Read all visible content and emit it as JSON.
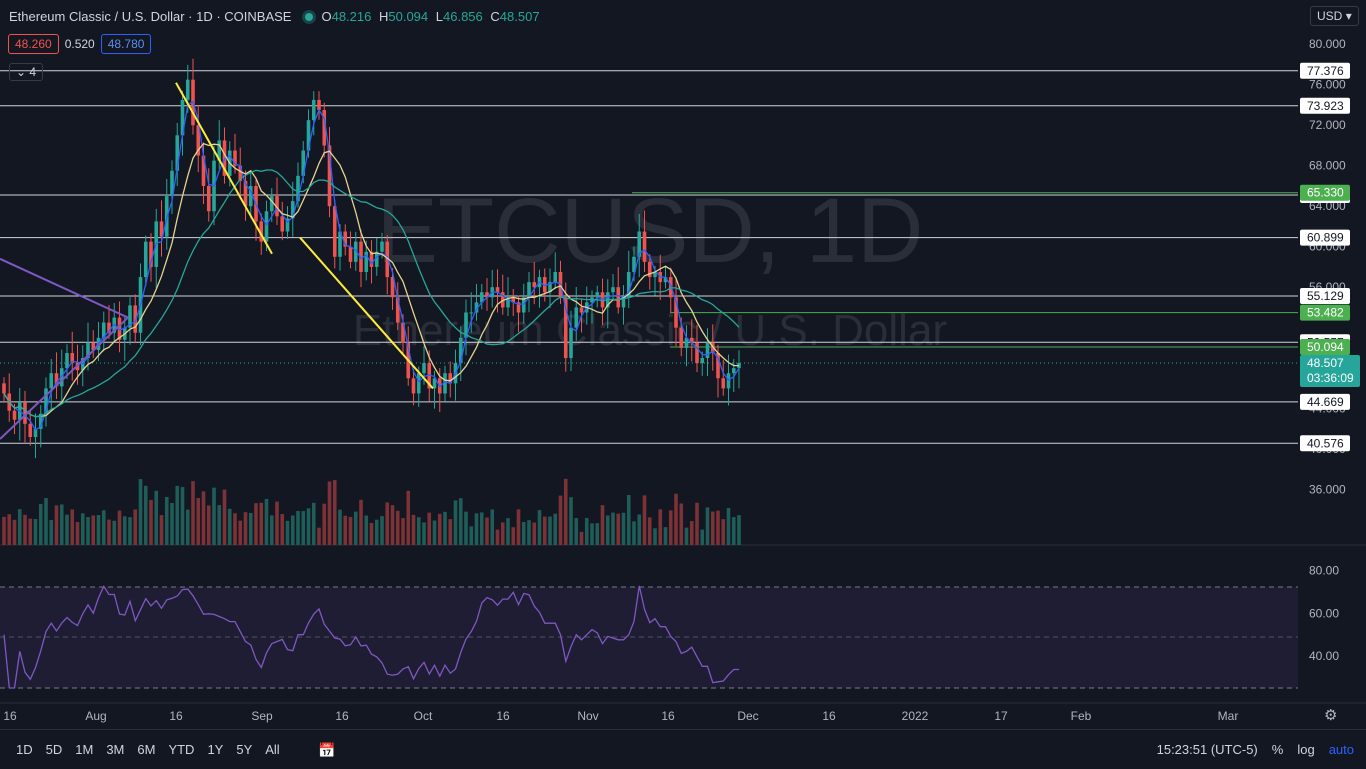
{
  "header": {
    "title": "Ethereum Classic / U.S. Dollar · 1D · COINBASE",
    "ohlc": [
      {
        "k": "O",
        "v": "48.216"
      },
      {
        "k": "H",
        "v": "50.094"
      },
      {
        "k": "L",
        "v": "46.856"
      },
      {
        "k": "C",
        "v": "48.507"
      }
    ]
  },
  "indicator": {
    "bid": "48.260",
    "spread": "0.520",
    "ask": "48.780"
  },
  "collapse_label": "4",
  "currency_button": "USD",
  "watermark": {
    "line1": "ETCUSD, 1D",
    "line2": "Ethereum Classic / U.S. Dollar"
  },
  "price_axis": {
    "min": 33,
    "max": 82,
    "ticks": [
      "80.000",
      "76.000",
      "72.000",
      "68.000",
      "64.000",
      "60.000",
      "56.000",
      "44.000",
      "40.000",
      "36.000"
    ],
    "tick_values": [
      80,
      76,
      72,
      68,
      64,
      60,
      56,
      44,
      40,
      36
    ]
  },
  "levels": [
    {
      "label": "77.376",
      "value": 77.376,
      "color": "#ffffff"
    },
    {
      "label": "73.923",
      "value": 73.923,
      "color": "#ffffff"
    },
    {
      "label": "65.108",
      "value": 65.108,
      "color": "#ffffff"
    },
    {
      "label": "60.899",
      "value": 60.899,
      "color": "#ffffff"
    },
    {
      "label": "55.129",
      "value": 55.129,
      "color": "#ffffff"
    },
    {
      "label": "50.557",
      "value": 50.557,
      "color": "#ffffff"
    },
    {
      "label": "44.669",
      "value": 44.669,
      "color": "#ffffff"
    },
    {
      "label": "40.576",
      "value": 40.576,
      "color": "#ffffff"
    }
  ],
  "green_levels": [
    {
      "label": "65.330",
      "value": 65.33
    },
    {
      "label": "53.482",
      "value": 53.482
    },
    {
      "label": "50.094",
      "value": 50.094
    }
  ],
  "current_price": {
    "label": "48.507",
    "countdown": "03:36:09",
    "value": 48.507
  },
  "rsi_axis": {
    "ticks": [
      "80.00",
      "60.00",
      "40.00"
    ],
    "tick_values": [
      80,
      60,
      40
    ]
  },
  "time_axis": [
    "16",
    "Aug",
    "16",
    "Sep",
    "16",
    "Oct",
    "16",
    "Nov",
    "16",
    "Dec",
    "16",
    "2022",
    "17",
    "Feb",
    "Mar"
  ],
  "bottom": {
    "ranges": [
      "1D",
      "5D",
      "1M",
      "3M",
      "6M",
      "YTD",
      "1Y",
      "5Y",
      "All"
    ],
    "time": "15:23:51 (UTC-5)",
    "pct": "%",
    "log": "log",
    "auto": "auto"
  },
  "colors": {
    "up": "#26a69a",
    "down": "#ef5350",
    "background": "#131722",
    "trendline_yellow": "#ffeb3b",
    "trendline_purple": "#7e57c2",
    "ma_blue": "#2962ff",
    "ma_teal": "#26a69a"
  },
  "chart_data": {
    "type": "candlestick",
    "closes": [
      45.5,
      43.8,
      42.9,
      44.6,
      42.5,
      41.2,
      42.0,
      43.5,
      46.0,
      47.5,
      46.2,
      48.0,
      49.5,
      48.5,
      47.8,
      49.0,
      50.5,
      49.8,
      51.0,
      52.5,
      51.5,
      53.0,
      50.8,
      52.0,
      54.2,
      51.5,
      57.0,
      60.5,
      58.0,
      62.5,
      61.0,
      65.0,
      67.5,
      71.0,
      74.5,
      76.5,
      72.0,
      69.0,
      66.0,
      63.5,
      68.5,
      70.5,
      67.0,
      69.5,
      68.0,
      66.5,
      64.0,
      66.0,
      62.5,
      60.5,
      63.5,
      65.0,
      63.0,
      61.5,
      62.8,
      64.5,
      67.0,
      69.5,
      72.5,
      74.5,
      73.5,
      70.0,
      64.0,
      59.0,
      61.5,
      60.0,
      58.5,
      60.5,
      57.5,
      59.5,
      58.0,
      59.5,
      60.5,
      57.0,
      55.0,
      52.5,
      50.5,
      47.0,
      45.5,
      47.5,
      48.5,
      46.0,
      47.0,
      45.5,
      47.5,
      46.5,
      48.5,
      51.0,
      53.5,
      53.5,
      54.5,
      55.5,
      55.0,
      56.0,
      55.5,
      54.0,
      55.0,
      54.5,
      53.5,
      55.0,
      56.5,
      56.0,
      57.0,
      55.5,
      56.5,
      57.5,
      55.0,
      49.0,
      52.0,
      54.0,
      53.5,
      54.5,
      55.0,
      55.5,
      54.0,
      55.5,
      56.0,
      54.0,
      55.0,
      57.5,
      59.0,
      61.5,
      58.5,
      57.0,
      57.5,
      56.5,
      57.0,
      55.0,
      52.0,
      50.0,
      51.0,
      50.5,
      48.5,
      49.0,
      50.5,
      49.5,
      47.0,
      46.0,
      47.5,
      48.0,
      48.507
    ]
  }
}
